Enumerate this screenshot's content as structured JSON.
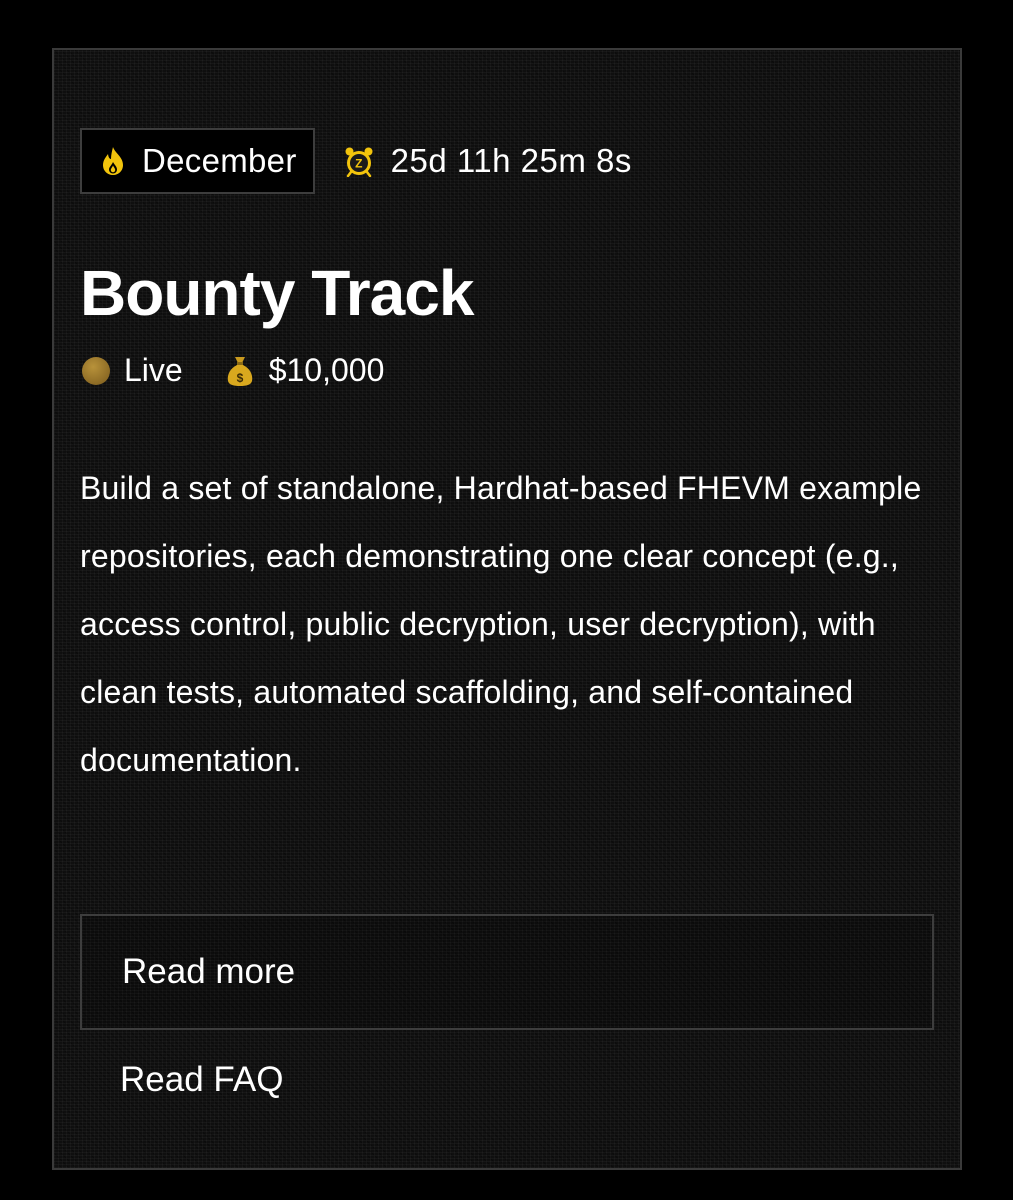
{
  "bounty": {
    "month_label": "December",
    "month_icon": "flame-icon",
    "countdown": "25d 11h 25m 8s",
    "countdown_icon": "alarm-clock-icon",
    "title": "Bounty Track",
    "status": "Live",
    "status_icon": "status-dot-icon",
    "prize": "$10,000",
    "prize_icon": "money-bag-icon",
    "description": "Build a set of standalone, Hardhat-based FHEVM example repositories, each demonstrating one clear concept (e.g., access control, public decryption, user decryption), with clean tests, automated scaffolding, and self-contained documentation.",
    "read_more_label": "Read more",
    "read_faq_label": "Read FAQ"
  },
  "colors": {
    "background": "#000000",
    "card_background": "#0f0f0f",
    "border": "#3d3d3d",
    "text": "#ffffff",
    "accent": "#f2c40c",
    "live_dot": "#9a7428"
  }
}
